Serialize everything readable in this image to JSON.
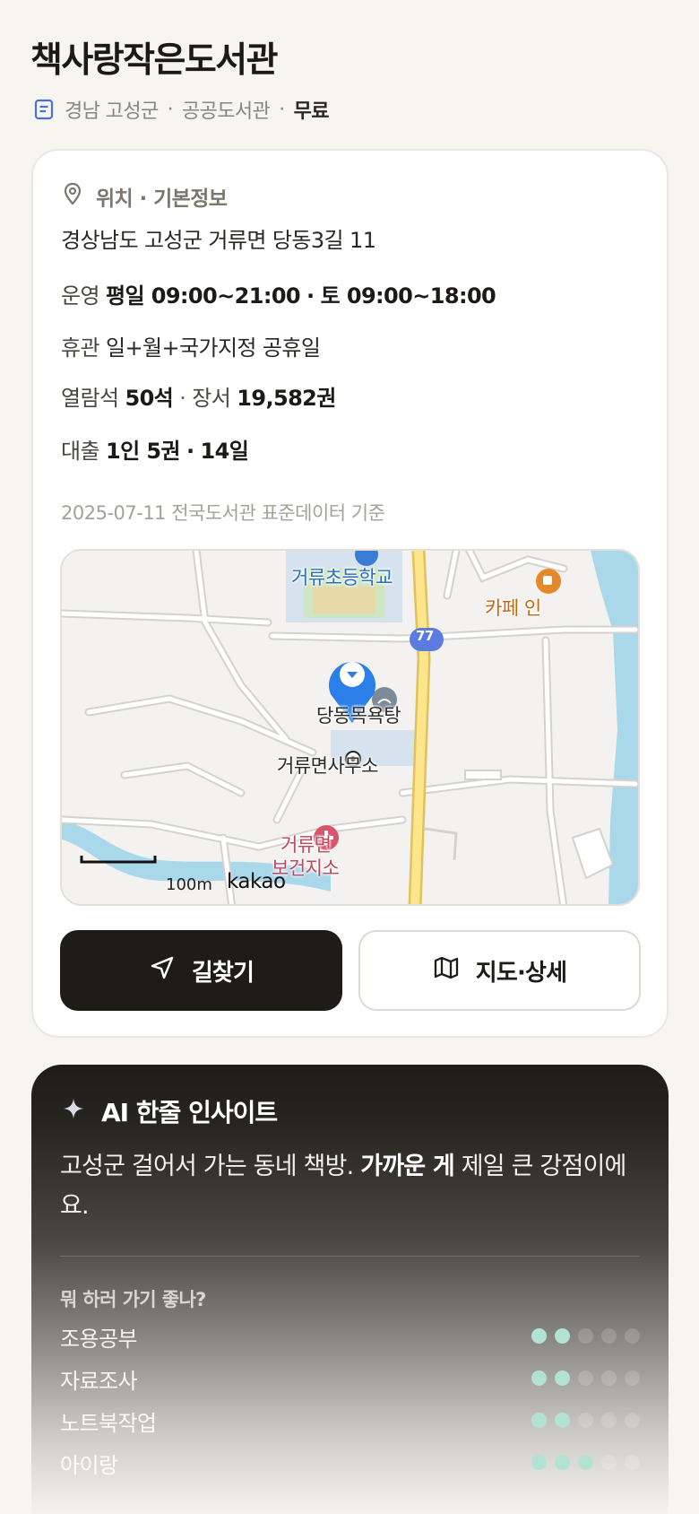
{
  "header": {
    "title": "책사랑작은도서관",
    "region": "경남 고성군",
    "category": "공공도서관",
    "fee": "무료",
    "sep": "·"
  },
  "info": {
    "section_title": "위치 · 기본정보",
    "address": "경상남도 고성군 거류면 당동3길 11",
    "hours_label": "운영",
    "hours_weekday": "평일 09:00~21:00",
    "hours_sat": "토 09:00~18:00",
    "closed_label": "휴관",
    "closed_value": "일+월+국가지정 공휴일",
    "seats_label": "열람석",
    "seats_value": "50석",
    "books_label": "장서",
    "books_value": "19,582권",
    "loan_label": "대출",
    "loan_value": "1인 5권",
    "loan_days": "14일",
    "dot": "·",
    "data_source": "2025-07-11 전국도서관 표준데이터 기준"
  },
  "map": {
    "labels": {
      "school": "거류초등학교",
      "cafe": "카페 인",
      "bath": "당동목욕탕",
      "office": "거류면사무소",
      "health1": "거류면",
      "health2": "보건지소",
      "road": "77"
    },
    "scale": "100m",
    "provider": "kakao"
  },
  "actions": {
    "route_label": "길찾기",
    "map_label": "지도·상세"
  },
  "ai": {
    "title": "AI 한줄 인사이트",
    "text_pre": "고성군 걸어서 가는 동네 책방. ",
    "text_bold": "가까운 게",
    "text_post": " 제일 큰 강점이에요.",
    "question": "뭐 하러 가기 좋나?",
    "ratings": [
      {
        "label": "조용공부",
        "score": 2,
        "max": 5
      },
      {
        "label": "자료조사",
        "score": 2,
        "max": 5
      },
      {
        "label": "노트북작업",
        "score": 2,
        "max": 5
      },
      {
        "label": "아이랑",
        "score": 3,
        "max": 5
      }
    ]
  },
  "colors": {
    "accent_dark": "#1e1c19",
    "rating_on": "#b3e2d5",
    "map_pin": "#2a7fe8"
  }
}
